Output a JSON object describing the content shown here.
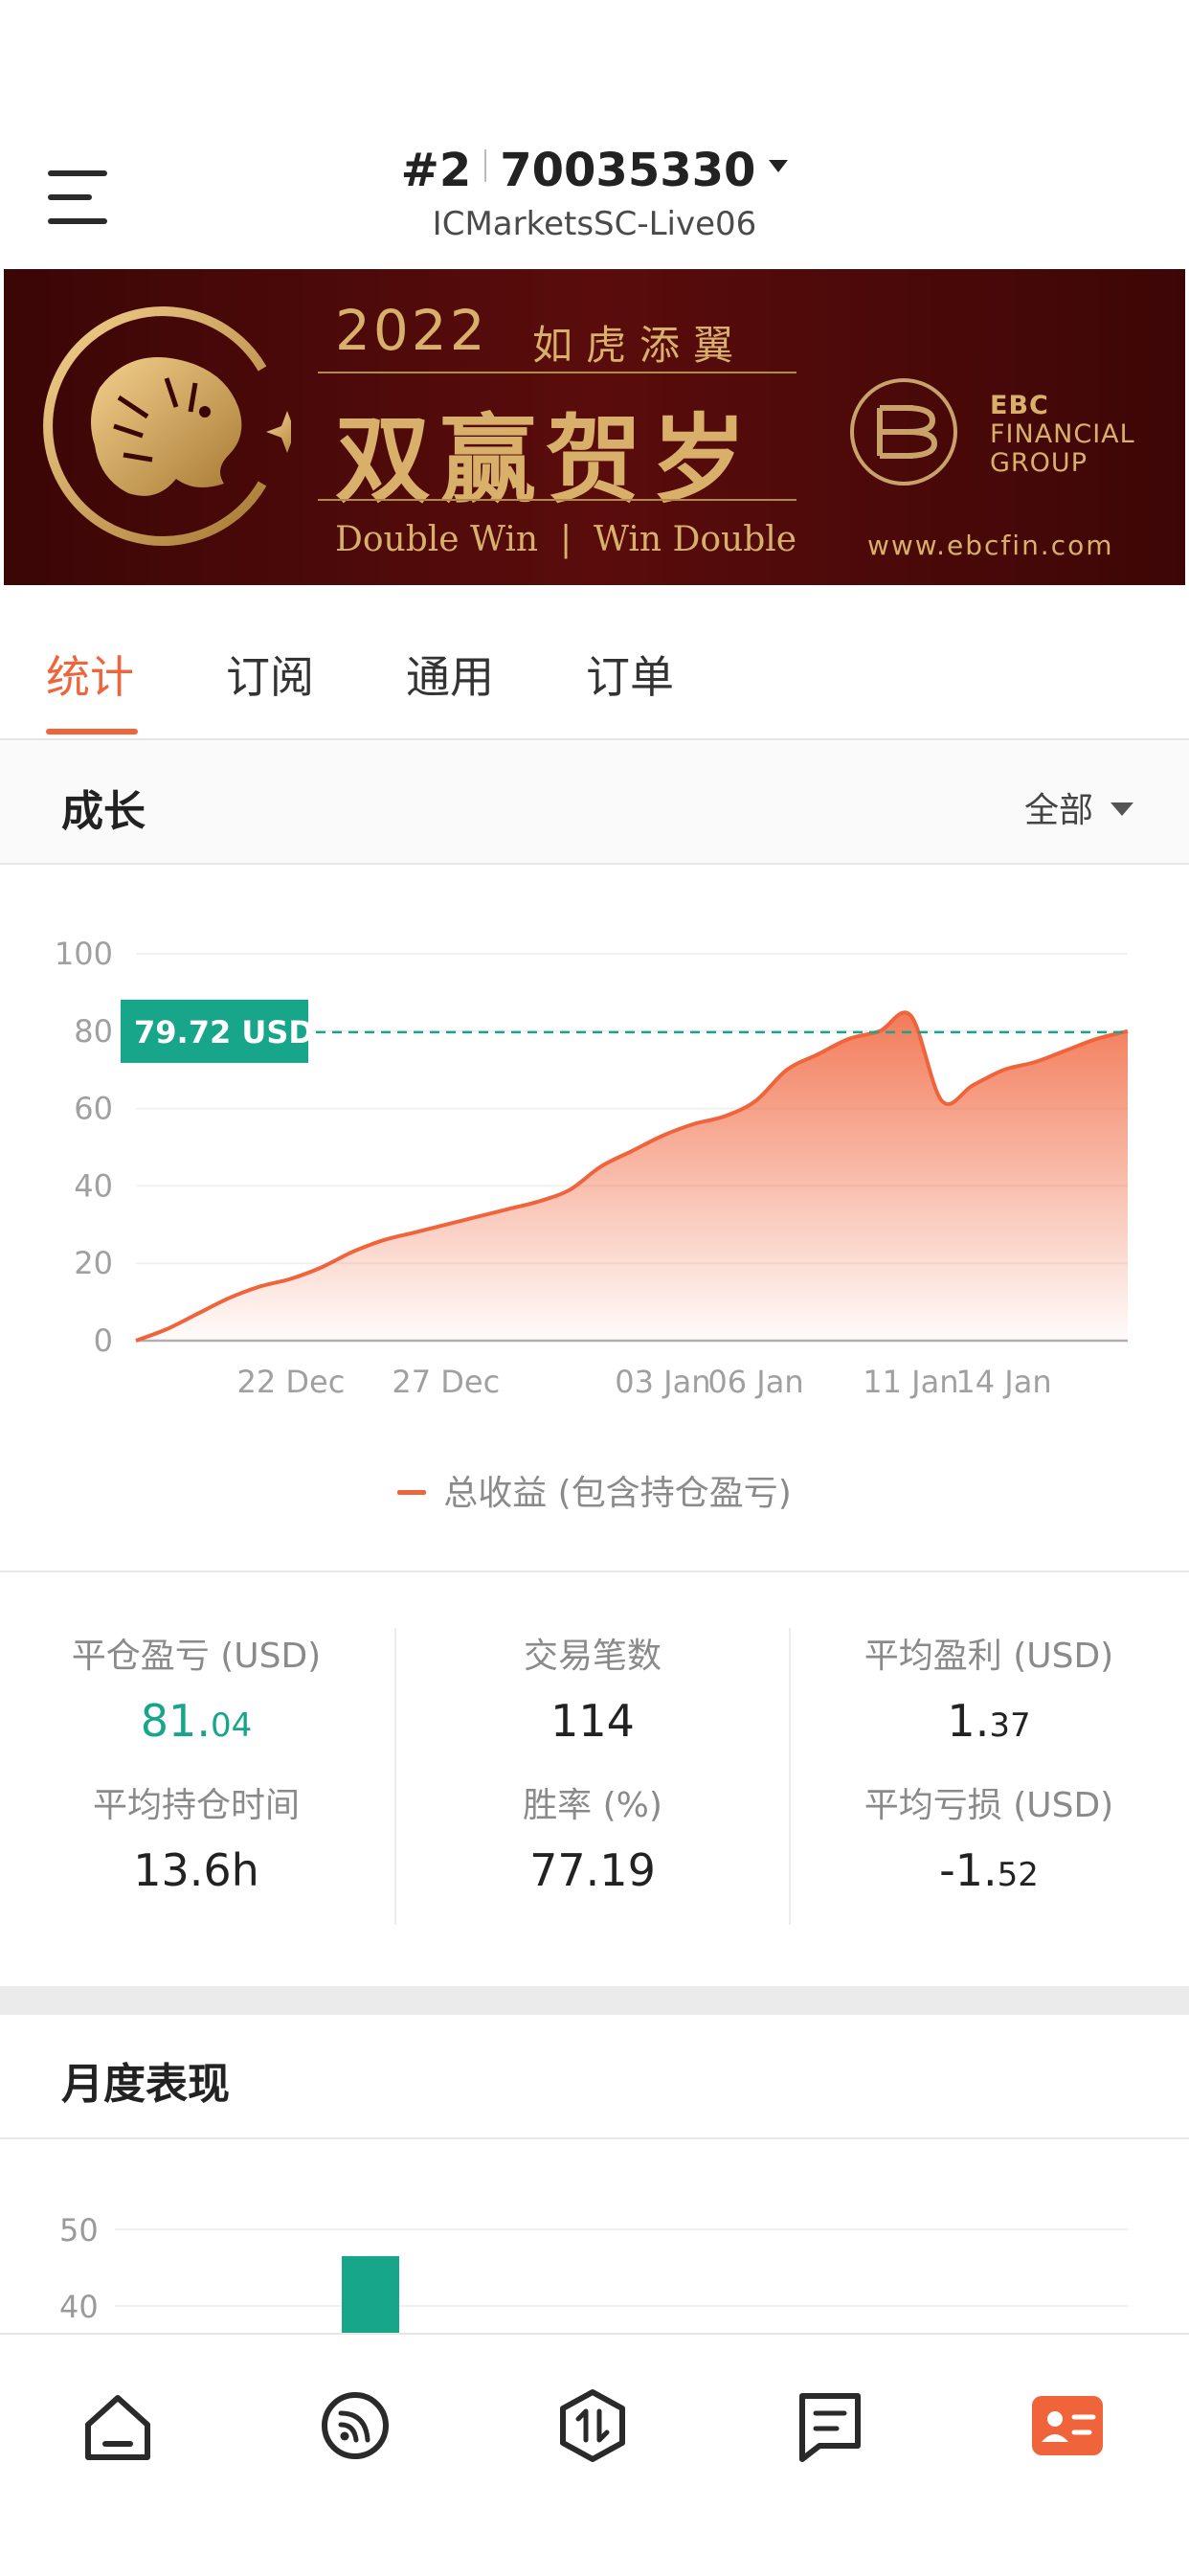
{
  "header": {
    "account_prefix": "#2",
    "account_number": "70035330",
    "server": "ICMarketsSC-Live06"
  },
  "banner": {
    "year": "2022",
    "year_subtitle": "如虎添翼",
    "main_text": "双赢贺岁",
    "english_text": "Double Win  |  Win Double",
    "brand_line1": "EBC",
    "brand_line2": "FINANCIAL",
    "brand_line3": "GROUP",
    "url": "www.ebcfin.com"
  },
  "tabs": [
    {
      "label": "统计",
      "active": true
    },
    {
      "label": "订阅",
      "active": false
    },
    {
      "label": "通用",
      "active": false
    },
    {
      "label": "订单",
      "active": false
    }
  ],
  "growth": {
    "title": "成长",
    "range_label": "全部",
    "current_value_label": "79.72 USD",
    "legend": "总收益 (包含持仓盈亏)"
  },
  "chart_data": {
    "type": "area",
    "y_ticks": [
      "100",
      "80",
      "60",
      "40",
      "20",
      "0"
    ],
    "ylim": [
      0,
      100
    ],
    "x_ticks": [
      "22 Dec",
      "27 Dec",
      "03 Jan",
      "06 Jan",
      "11 Jan",
      "14 Jan"
    ],
    "series": [
      {
        "name": "总收益 (包含持仓盈亏)",
        "x": [
          "17 Dec",
          "18 Dec",
          "19 Dec",
          "20 Dec",
          "21 Dec",
          "22 Dec",
          "23 Dec",
          "24 Dec",
          "25 Dec",
          "26 Dec",
          "27 Dec",
          "28 Dec",
          "29 Dec",
          "30 Dec",
          "31 Dec",
          "01 Jan",
          "02 Jan",
          "03 Jan",
          "04 Jan",
          "05 Jan",
          "06 Jan",
          "07 Jan",
          "08 Jan",
          "09 Jan",
          "10 Jan",
          "11 Jan",
          "12 Jan",
          "13 Jan",
          "14 Jan",
          "15 Jan",
          "16 Jan",
          "17 Jan",
          "18 Jan"
        ],
        "values": [
          0,
          3,
          7,
          11,
          14,
          16,
          19,
          23,
          26,
          28,
          30,
          32,
          34,
          36,
          39,
          45,
          49,
          53,
          56,
          58,
          62,
          70,
          74,
          78,
          80,
          84,
          62,
          66,
          70,
          72,
          75,
          78,
          80
        ]
      }
    ],
    "reference_line": 79.72,
    "reference_label": "79.72 USD",
    "grid": true
  },
  "stats": {
    "closed_pl": {
      "label": "平仓盈亏 (USD)",
      "int": "81.",
      "dec": "04"
    },
    "trades": {
      "label": "交易笔数",
      "value": "114"
    },
    "avg_profit": {
      "label": "平均盈利 (USD)",
      "int": "1.",
      "dec": "37"
    },
    "avg_hold": {
      "label": "平均持仓时间",
      "value": "13.6h"
    },
    "win_rate": {
      "label": "胜率 (%)",
      "value": "77.19"
    },
    "avg_loss": {
      "label": "平均亏损 (USD)",
      "int": "-1.",
      "dec": "52"
    }
  },
  "monthly": {
    "title": "月度表现",
    "y_ticks": [
      "50",
      "40"
    ],
    "bar_color": "#17a68a"
  },
  "colors": {
    "accent": "#f0643c",
    "green": "#17a68a",
    "banner_bg": "#4a0909",
    "gold": "#d9b06a"
  },
  "nav_icons": [
    "home-icon",
    "feed-icon",
    "trade-icon",
    "message-icon",
    "profile-card-icon"
  ]
}
